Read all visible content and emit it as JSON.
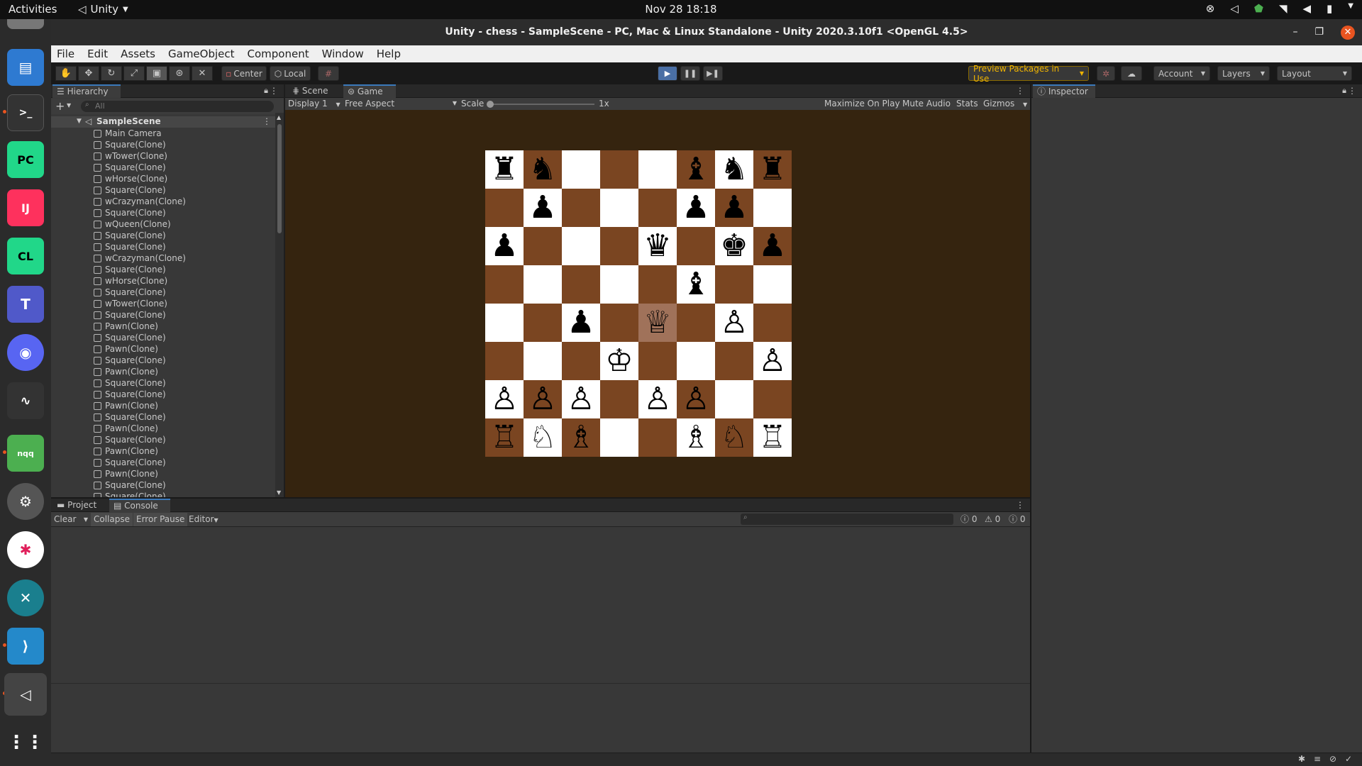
{
  "topbar": {
    "activities": "Activities",
    "app_name": "Unity",
    "clock": "Nov 28  18:18"
  },
  "window": {
    "title": "Unity - chess - SampleScene - PC, Mac & Linux Standalone - Unity 2020.3.10f1 <OpenGL 4.5>"
  },
  "menu": [
    "File",
    "Edit",
    "Assets",
    "GameObject",
    "Component",
    "Window",
    "Help"
  ],
  "toolbar": {
    "pivot": "Center",
    "space": "Local",
    "preview_packages": "Preview Packages in Use",
    "account": "Account",
    "layers": "Layers",
    "layout": "Layout"
  },
  "hierarchy": {
    "tab": "Hierarchy",
    "search_placeholder": "All",
    "scene": "SampleScene",
    "items": [
      "Main Camera",
      "Square(Clone)",
      "wTower(Clone)",
      "Square(Clone)",
      "wHorse(Clone)",
      "Square(Clone)",
      "wCrazyman(Clone)",
      "Square(Clone)",
      "wQueen(Clone)",
      "Square(Clone)",
      "Square(Clone)",
      "wCrazyman(Clone)",
      "Square(Clone)",
      "wHorse(Clone)",
      "Square(Clone)",
      "wTower(Clone)",
      "Square(Clone)",
      "Pawn(Clone)",
      "Square(Clone)",
      "Pawn(Clone)",
      "Square(Clone)",
      "Pawn(Clone)",
      "Square(Clone)",
      "Square(Clone)",
      "Pawn(Clone)",
      "Square(Clone)",
      "Pawn(Clone)",
      "Square(Clone)",
      "Pawn(Clone)",
      "Square(Clone)",
      "Pawn(Clone)",
      "Square(Clone)",
      "Square(Clone)"
    ]
  },
  "game": {
    "tabs": [
      "Scene",
      "Game"
    ],
    "display": "Display 1",
    "aspect": "Free Aspect",
    "scale_label": "Scale",
    "scale_value": "1x",
    "maximize": "Maximize On Play",
    "mute": "Mute Audio",
    "stats": "Stats",
    "gizmos": "Gizmos",
    "board": [
      [
        "♜",
        "♞",
        "",
        "",
        "",
        "♝",
        "♞",
        "♜"
      ],
      [
        "",
        "♟",
        "",
        "",
        "",
        "♟",
        "♟",
        ""
      ],
      [
        "♟",
        "",
        "",
        "",
        "♛",
        "",
        "♚",
        "♟"
      ],
      [
        "",
        "",
        "",
        "",
        "",
        "♝",
        "",
        ""
      ],
      [
        "",
        "",
        "♟",
        "",
        "♕",
        "",
        "♙",
        ""
      ],
      [
        "",
        "",
        "",
        "♔",
        "",
        "",
        "",
        "♙"
      ],
      [
        "♙",
        "♙",
        "♙",
        "",
        "♙",
        "♙",
        "",
        ""
      ],
      [
        "♖",
        "♘",
        "♗",
        "",
        "",
        "♗",
        "♘",
        "♖"
      ]
    ],
    "highlight": {
      "row": 4,
      "col": 4
    }
  },
  "inspector": {
    "tab": "Inspector"
  },
  "console": {
    "tabs": [
      "Project",
      "Console"
    ],
    "clear": "Clear",
    "collapse": "Collapse",
    "error_pause": "Error Pause",
    "editor": "Editor",
    "counts": [
      "0",
      "0",
      "0"
    ]
  },
  "colors": {
    "dark_square": "#7a4521",
    "light_square": "#ffffff",
    "highlight_square": "#a0725a",
    "game_bg": "#35240f",
    "ubuntu_orange": "#e95420"
  }
}
